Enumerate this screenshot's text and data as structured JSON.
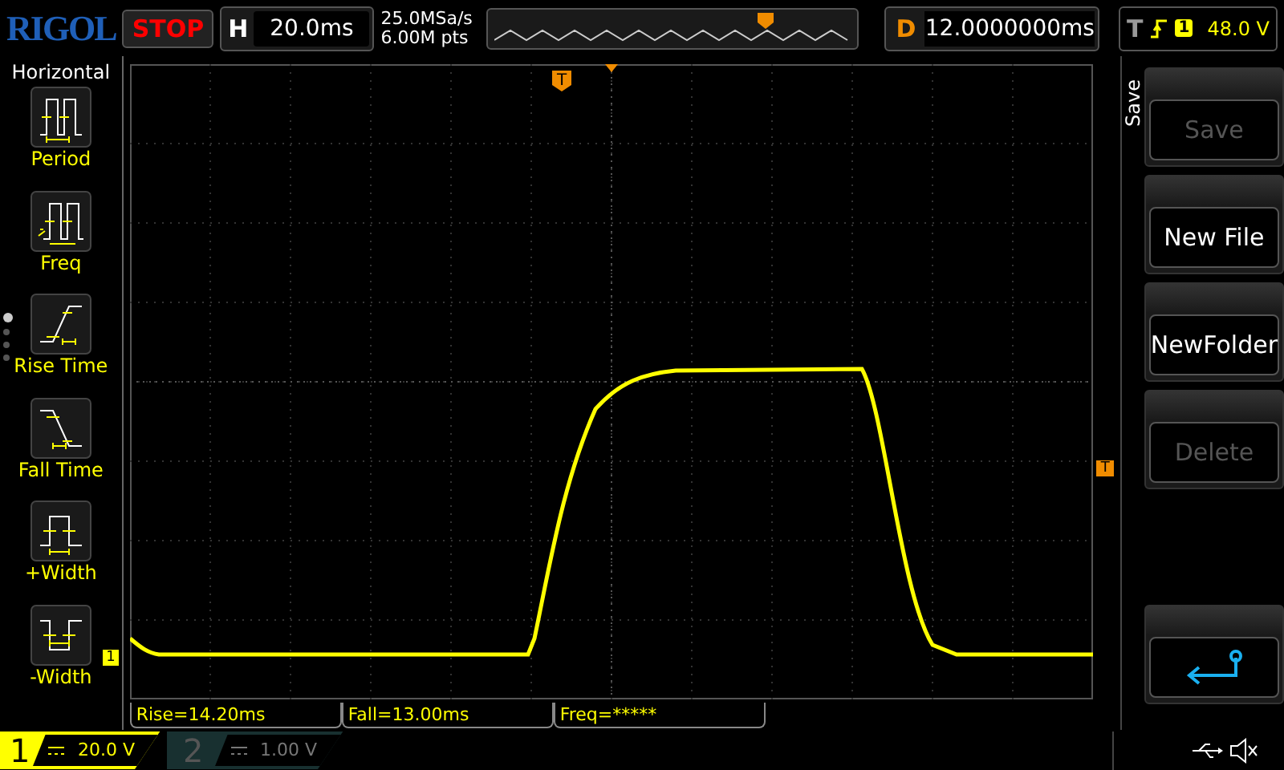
{
  "logo": "RIGOL",
  "run_state": "STOP",
  "horizontal": {
    "label": "H",
    "timebase": "20.0ms"
  },
  "acquisition": {
    "sample_rate": "25.0MSa/s",
    "memory_depth": "6.00M pts"
  },
  "delay": {
    "label": "D",
    "value": "12.0000000ms"
  },
  "trigger": {
    "label": "T",
    "source": "1",
    "level": "48.0 V"
  },
  "measure_menu": {
    "title": "Horizontal",
    "items": [
      {
        "label": "Period",
        "kind": "period"
      },
      {
        "label": "Freq",
        "kind": "freq"
      },
      {
        "label": "Rise Time",
        "kind": "rise"
      },
      {
        "label": "Fall Time",
        "kind": "fall"
      },
      {
        "label": "+Width",
        "kind": "pwidth"
      },
      {
        "label": "-Width",
        "kind": "nwidth"
      }
    ],
    "pages": [
      {
        "selected": true
      },
      {
        "selected": false
      },
      {
        "selected": false
      },
      {
        "selected": false
      }
    ]
  },
  "grid": {
    "trigger_marker": "T",
    "level_marker": "T",
    "channel_marker": "1"
  },
  "measurements": [
    "Rise=14.20ms",
    "Fall=13.00ms",
    "Freq=*****"
  ],
  "channels": [
    {
      "number": "1",
      "scale": "20.0 V",
      "enabled": true
    },
    {
      "number": "2",
      "scale": "1.00 V",
      "enabled": false
    }
  ],
  "softkeys": {
    "title": "Save",
    "buttons": [
      {
        "kind": "text",
        "label": "Save",
        "disabled": true
      },
      {
        "kind": "text",
        "label": "New File",
        "disabled": false
      },
      {
        "kind": "text",
        "label": "NewFolder",
        "disabled": false
      },
      {
        "kind": "text",
        "label": "Delete",
        "disabled": true
      },
      {
        "kind": "back",
        "disabled": false
      }
    ]
  }
}
